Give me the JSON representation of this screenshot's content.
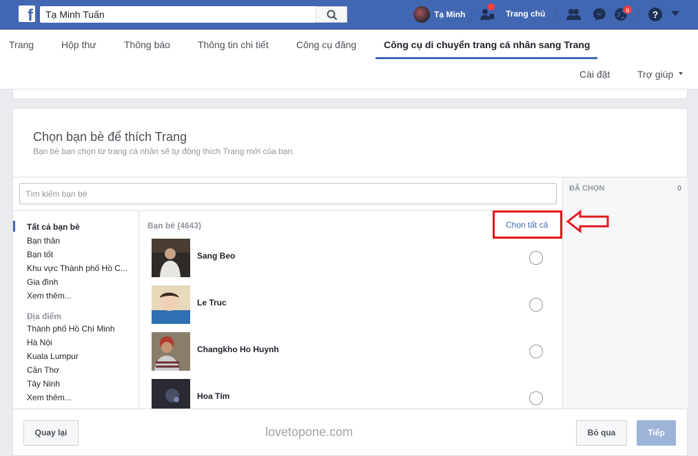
{
  "topbar": {
    "search_value": "Tạ Minh Tuấn",
    "profile_name": "Tạ Minh",
    "home_label": "Trang chủ",
    "notification_badge": "6"
  },
  "nav": {
    "tabs": [
      "Trang",
      "Hộp thư",
      "Thông báo",
      "Thông tin chi tiết",
      "Công cụ đăng",
      "Công cụ di chuyển trang cá nhân sang Trang"
    ],
    "settings_label": "Cài đặt",
    "help_label": "Trợ giúp"
  },
  "dialog": {
    "title": "Chọn bạn bè để thích Trang",
    "subtitle": "Bạn bè bạn chọn từ trang cá nhân sẽ tự động thích Trang mới của bạn.",
    "search_placeholder": "Tìm kiếm bạn bè",
    "selected_label": "ĐÃ CHỌN",
    "selected_count": "0",
    "categories": [
      "Tất cả bạn bè",
      "Bạn thân",
      "Bạn tốt",
      "Khu vực Thành phố Hồ C...",
      "Gia đình",
      "Xem thêm..."
    ],
    "location_heading": "Địa điểm",
    "locations": [
      "Thành phố Hồ Chí Minh",
      "Hà Nội",
      "Kuala Lumpur",
      "Cần Thơ",
      "Tây Ninh",
      "Xem thêm..."
    ],
    "list_heading": "Bạn bè (4643)",
    "select_all_label": "Chọn tất cả",
    "friends": [
      {
        "name": "Sang Beo"
      },
      {
        "name": "Le Truc"
      },
      {
        "name": "Changkho Ho Huynh"
      },
      {
        "name": "Hoa Tím"
      }
    ],
    "back_label": "Quay lại",
    "skip_label": "Bỏ qua",
    "next_label": "Tiếp"
  },
  "watermark": "lovetopone.com",
  "colors": {
    "brand": "#4267b2",
    "highlight": "#e3161c"
  }
}
